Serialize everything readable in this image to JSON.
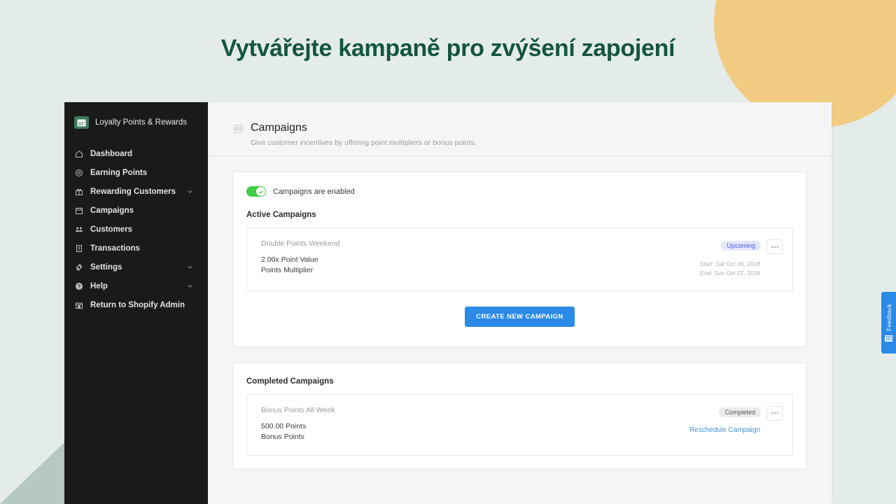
{
  "headline": "Vytvářejte kampaně pro zvýšení zapojení",
  "theme": {
    "background": "#e4ecea",
    "headline_color": "#14553f",
    "circle_color": "#f1cb82",
    "triangle_color": "#b6c8c2",
    "sidebar_bg": "#1a1a1a",
    "accent_blue": "#2b8ae8",
    "toggle_green": "#3fcb45"
  },
  "sidebar": {
    "brand": {
      "name": "Loyalty Points & Rewards",
      "logo_icon": "calendar-logo-icon"
    },
    "items": [
      {
        "label": "Dashboard",
        "icon": "home-icon",
        "chevron": false
      },
      {
        "label": "Earning Points",
        "icon": "target-icon",
        "chevron": false
      },
      {
        "label": "Rewarding Customers",
        "icon": "gift-icon",
        "chevron": true
      },
      {
        "label": "Campaigns",
        "icon": "calendar-icon",
        "chevron": false
      },
      {
        "label": "Customers",
        "icon": "people-icon",
        "chevron": false
      },
      {
        "label": "Transactions",
        "icon": "receipt-icon",
        "chevron": false
      },
      {
        "label": "Settings",
        "icon": "gear-icon",
        "chevron": true
      },
      {
        "label": "Help",
        "icon": "help-icon",
        "chevron": true
      },
      {
        "label": "Return to Shopify Admin",
        "icon": "store-icon",
        "chevron": false
      }
    ]
  },
  "main": {
    "header": {
      "icon": "calendar-icon",
      "title": "Campaigns",
      "subtitle": "Give customer incentives by offering point multipliers or bonus points."
    },
    "toggle": {
      "label": "Campaigns are enabled",
      "state": "on"
    },
    "active_section": {
      "title": "Active Campaigns",
      "campaign": {
        "name": "Double Points Weekend",
        "value": "2.00x Point Value",
        "type": "Points Multiplier",
        "badge": "Upcoming",
        "start_date": "Start: Sat Oct 06, 2018",
        "end_date": "End: Sun Oct 07, 2018",
        "menu_icon": "kebab-menu-icon"
      },
      "cta_label": "CREATE NEW CAMPAIGN"
    },
    "completed_section": {
      "title": "Completed Campaigns",
      "campaign": {
        "name": "Bonus Points All Week",
        "value": "500.00 Points",
        "type": "Bonus Points",
        "badge": "Completed",
        "link_label": "Reschedule Campaign",
        "menu_icon": "kebab-menu-icon"
      }
    }
  },
  "feedback_tab": {
    "label": "Feedback",
    "icon": "feedback-icon"
  }
}
